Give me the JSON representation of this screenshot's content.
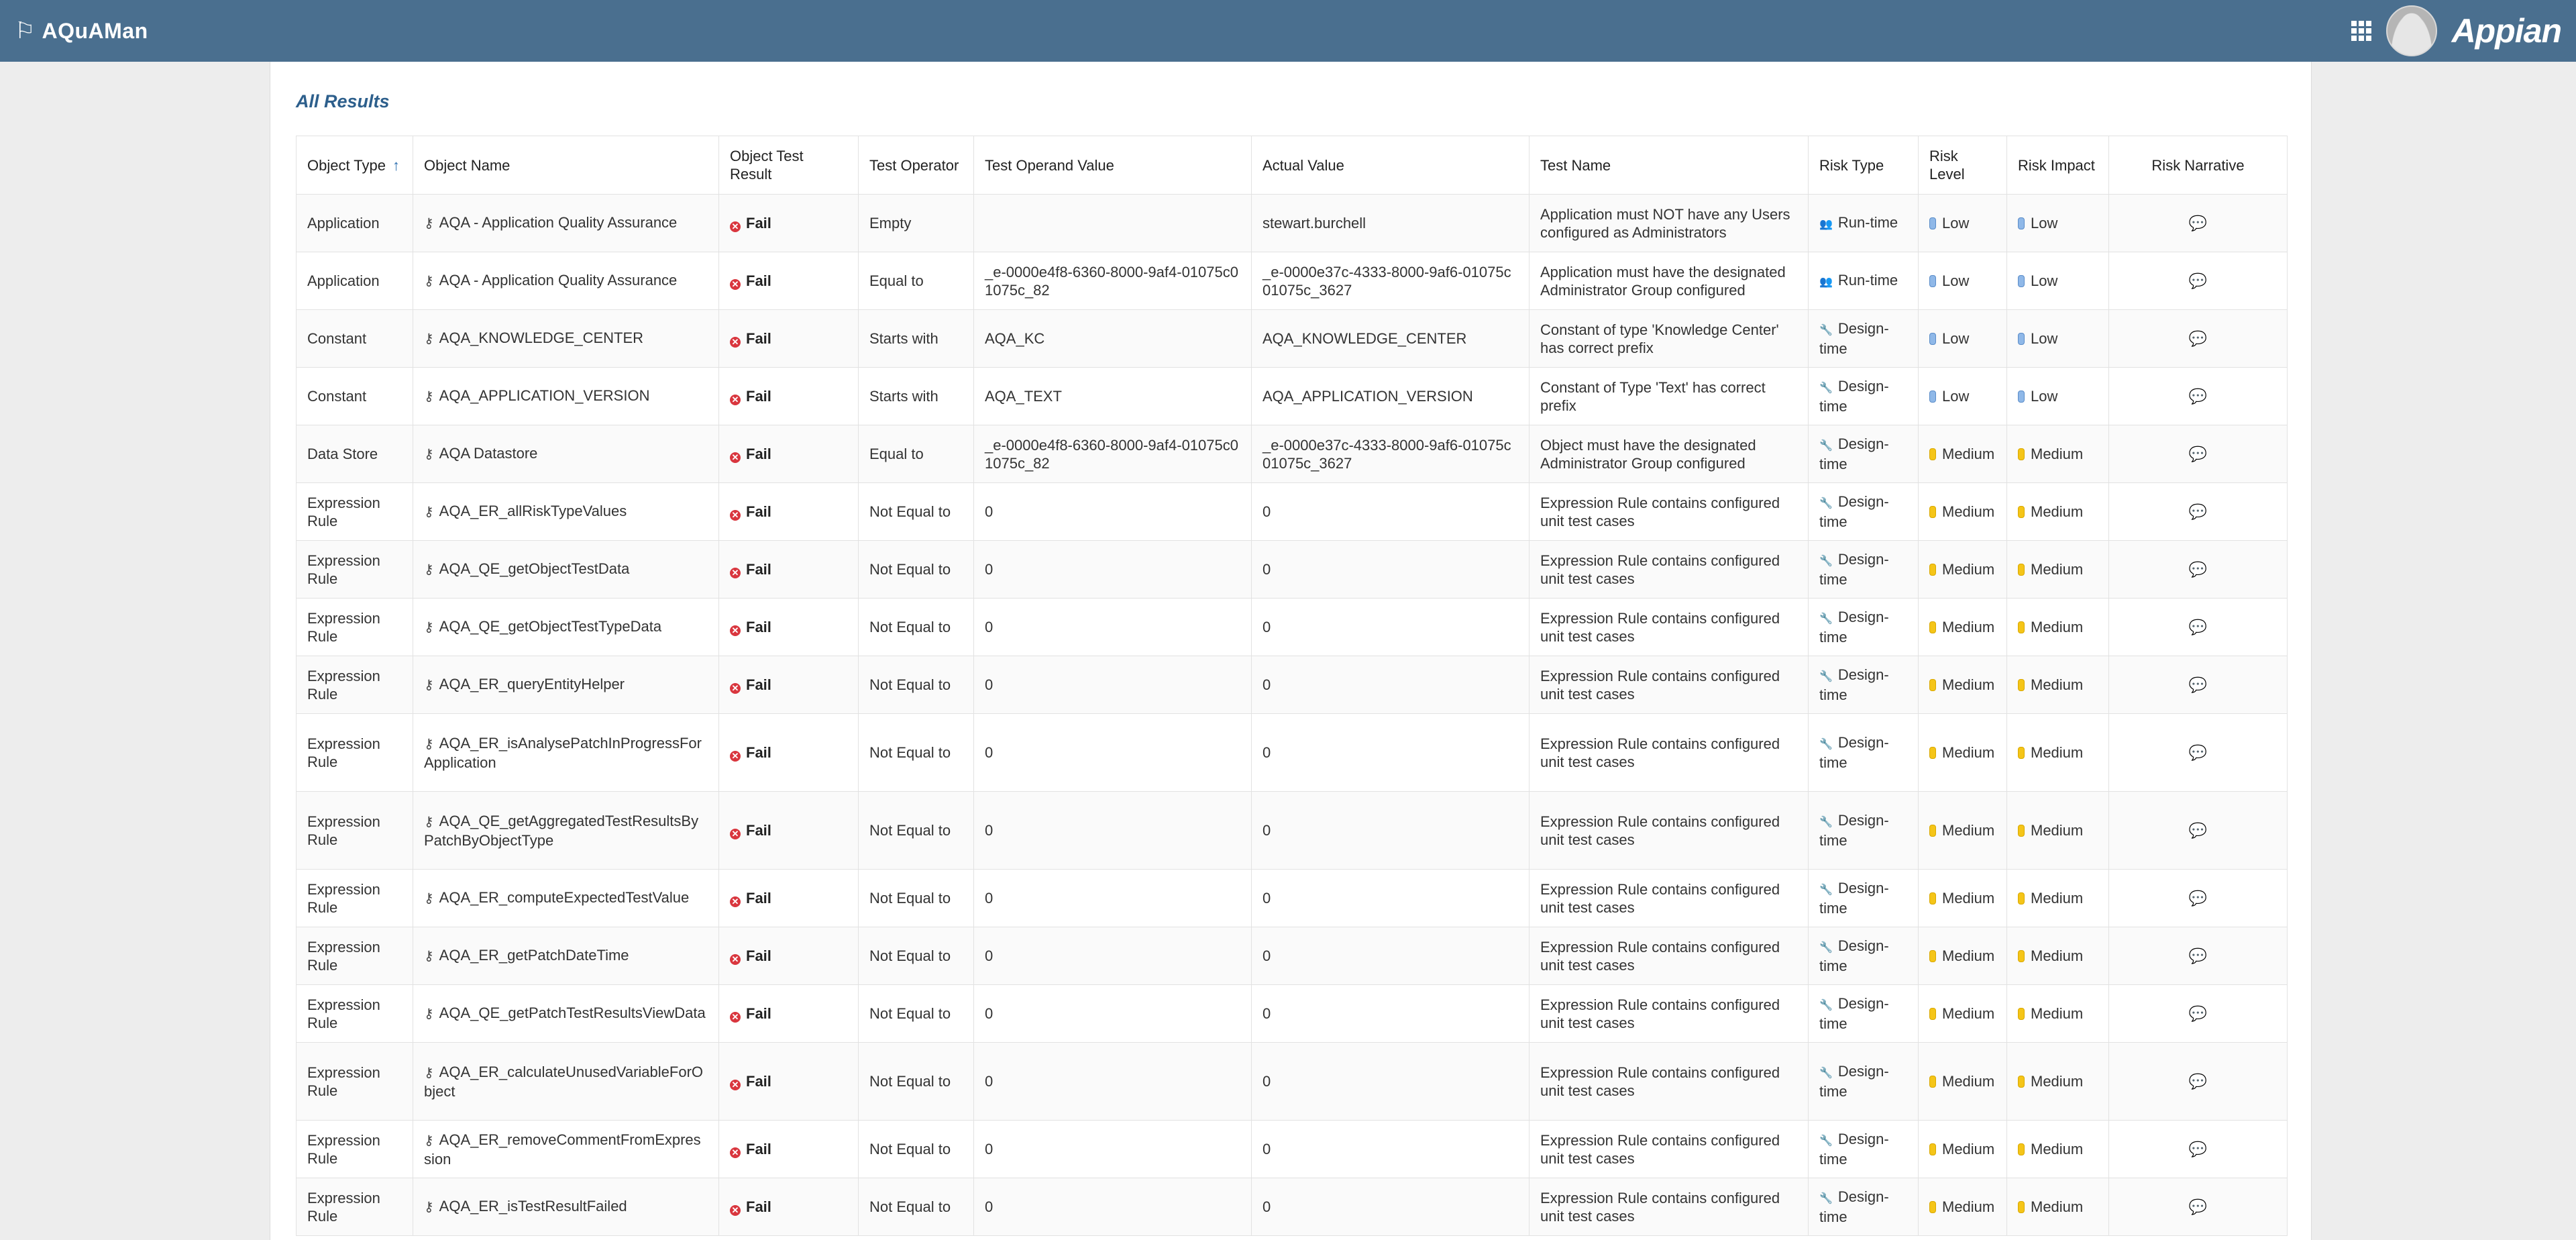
{
  "app": {
    "title": "AQuAMan",
    "logo": "Appian",
    "flag_icon": "flag-icon",
    "apps_icon": "grid-icon"
  },
  "section": {
    "title": "All Results"
  },
  "table": {
    "columns": [
      "Object Type",
      "Object Name",
      "Object Test Result",
      "Test Operator",
      "Test Operand Value",
      "Actual Value",
      "Test Name",
      "Risk Type",
      "Risk Level",
      "Risk Impact",
      "Risk Narrative"
    ],
    "sort_indicator": "↑",
    "rows": [
      {
        "type": "Application",
        "name": "AQA - Application Quality Assurance",
        "result": "Fail",
        "operator": "Empty",
        "operand": "",
        "actual": "stewart.burchell",
        "test": "Application must NOT have any Users configured as Administrators",
        "risk_type": "Run-time",
        "risk_level": "Low",
        "risk_impact": "Low"
      },
      {
        "type": "Application",
        "name": "AQA - Application Quality Assurance",
        "result": "Fail",
        "operator": "Equal to",
        "operand": "_e-0000e4f8-6360-8000-9af4-01075c01075c_82",
        "actual": "_e-0000e37c-4333-8000-9af6-01075c01075c_3627",
        "test": "Application must have the designated Administrator Group configured",
        "risk_type": "Run-time",
        "risk_level": "Low",
        "risk_impact": "Low"
      },
      {
        "type": "Constant",
        "name": "AQA_KNOWLEDGE_CENTER",
        "result": "Fail",
        "operator": "Starts with",
        "operand": "AQA_KC",
        "actual": "AQA_KNOWLEDGE_CENTER",
        "test": "Constant of type 'Knowledge Center' has correct prefix",
        "risk_type": "Design-time",
        "risk_level": "Low",
        "risk_impact": "Low"
      },
      {
        "type": "Constant",
        "name": "AQA_APPLICATION_VERSION",
        "result": "Fail",
        "operator": "Starts with",
        "operand": "AQA_TEXT",
        "actual": "AQA_APPLICATION_VERSION",
        "test": "Constant of Type 'Text' has correct prefix",
        "risk_type": "Design-time",
        "risk_level": "Low",
        "risk_impact": "Low"
      },
      {
        "type": "Data Store",
        "name": "AQA Datastore",
        "result": "Fail",
        "operator": "Equal to",
        "operand": "_e-0000e4f8-6360-8000-9af4-01075c01075c_82",
        "actual": "_e-0000e37c-4333-8000-9af6-01075c01075c_3627",
        "test": "Object must have the designated Administrator Group configured",
        "risk_type": "Design-time",
        "risk_level": "Medium",
        "risk_impact": "Medium"
      },
      {
        "type": "Expression Rule",
        "name": "AQA_ER_allRiskTypeValues",
        "result": "Fail",
        "operator": "Not Equal to",
        "operand": "0",
        "actual": "0",
        "test": "Expression Rule contains configured unit test cases",
        "risk_type": "Design-time",
        "risk_level": "Medium",
        "risk_impact": "Medium"
      },
      {
        "type": "Expression Rule",
        "name": "AQA_QE_getObjectTestData",
        "result": "Fail",
        "operator": "Not Equal to",
        "operand": "0",
        "actual": "0",
        "test": "Expression Rule contains configured unit test cases",
        "risk_type": "Design-time",
        "risk_level": "Medium",
        "risk_impact": "Medium"
      },
      {
        "type": "Expression Rule",
        "name": "AQA_QE_getObjectTestTypeData",
        "result": "Fail",
        "operator": "Not Equal to",
        "operand": "0",
        "actual": "0",
        "test": "Expression Rule contains configured unit test cases",
        "risk_type": "Design-time",
        "risk_level": "Medium",
        "risk_impact": "Medium"
      },
      {
        "type": "Expression Rule",
        "name": "AQA_ER_queryEntityHelper",
        "result": "Fail",
        "operator": "Not Equal to",
        "operand": "0",
        "actual": "0",
        "test": "Expression Rule contains configured unit test cases",
        "risk_type": "Design-time",
        "risk_level": "Medium",
        "risk_impact": "Medium"
      },
      {
        "type": "Expression Rule",
        "name": "AQA_ER_isAnalysePatchInProgressForApplication",
        "result": "Fail",
        "operator": "Not Equal to",
        "operand": "0",
        "actual": "0",
        "test": "Expression Rule contains configured unit test cases",
        "risk_type": "Design-time",
        "risk_level": "Medium",
        "risk_impact": "Medium"
      },
      {
        "type": "Expression Rule",
        "name": "AQA_QE_getAggregatedTestResultsByPatchByObjectType",
        "result": "Fail",
        "operator": "Not Equal to",
        "operand": "0",
        "actual": "0",
        "test": "Expression Rule contains configured unit test cases",
        "risk_type": "Design-time",
        "risk_level": "Medium",
        "risk_impact": "Medium"
      },
      {
        "type": "Expression Rule",
        "name": "AQA_ER_computeExpectedTestValue",
        "result": "Fail",
        "operator": "Not Equal to",
        "operand": "0",
        "actual": "0",
        "test": "Expression Rule contains configured unit test cases",
        "risk_type": "Design-time",
        "risk_level": "Medium",
        "risk_impact": "Medium"
      },
      {
        "type": "Expression Rule",
        "name": "AQA_ER_getPatchDateTime",
        "result": "Fail",
        "operator": "Not Equal to",
        "operand": "0",
        "actual": "0",
        "test": "Expression Rule contains configured unit test cases",
        "risk_type": "Design-time",
        "risk_level": "Medium",
        "risk_impact": "Medium"
      },
      {
        "type": "Expression Rule",
        "name": "AQA_QE_getPatchTestResultsViewData",
        "result": "Fail",
        "operator": "Not Equal to",
        "operand": "0",
        "actual": "0",
        "test": "Expression Rule contains configured unit test cases",
        "risk_type": "Design-time",
        "risk_level": "Medium",
        "risk_impact": "Medium"
      },
      {
        "type": "Expression Rule",
        "name": "AQA_ER_calculateUnusedVariableForObject",
        "result": "Fail",
        "operator": "Not Equal to",
        "operand": "0",
        "actual": "0",
        "test": "Expression Rule contains configured unit test cases",
        "risk_type": "Design-time",
        "risk_level": "Medium",
        "risk_impact": "Medium"
      },
      {
        "type": "Expression Rule",
        "name": "AQA_ER_removeCommentFromExpression",
        "result": "Fail",
        "operator": "Not Equal to",
        "operand": "0",
        "actual": "0",
        "test": "Expression Rule contains configured unit test cases",
        "risk_type": "Design-time",
        "risk_level": "Medium",
        "risk_impact": "Medium"
      },
      {
        "type": "Expression Rule",
        "name": "AQA_ER_isTestResultFailed",
        "result": "Fail",
        "operator": "Not Equal to",
        "operand": "0",
        "actual": "0",
        "test": "Expression Rule contains configured unit test cases",
        "risk_type": "Design-time",
        "risk_level": "Medium",
        "risk_impact": "Medium"
      }
    ]
  }
}
